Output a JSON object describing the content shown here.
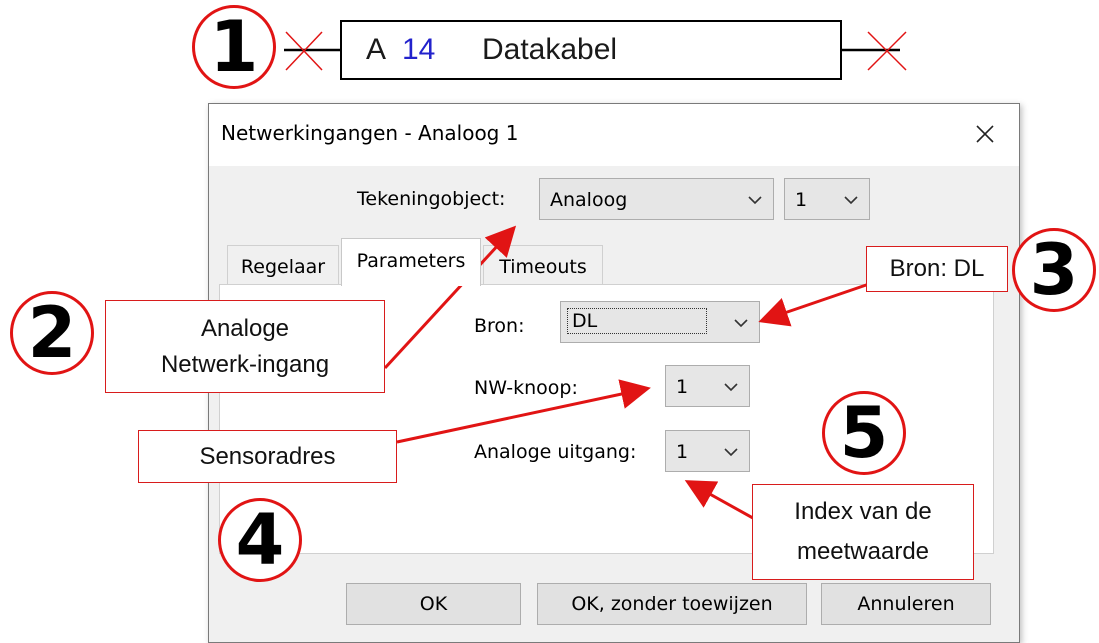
{
  "element": {
    "prefix": "A",
    "number": "14",
    "name": "Datakabel"
  },
  "callouts": [
    "1",
    "2",
    "3",
    "4",
    "5"
  ],
  "dialog": {
    "title": "Netwerkingangen - Analoog 1",
    "drawing_object_label": "Tekeningobject:",
    "drawing_object_value": "Analoog",
    "drawing_object_index": "1",
    "tabs": [
      {
        "label": "Regelaar",
        "active": false
      },
      {
        "label": "Parameters",
        "active": true
      },
      {
        "label": "Timeouts",
        "active": false
      }
    ],
    "fields": {
      "source_label": "Bron:",
      "source_value": "DL",
      "node_label": "NW-knoop:",
      "node_value": "1",
      "output_label": "Analoge uitgang:",
      "output_value": "1"
    },
    "buttons": {
      "ok": "OK",
      "ok_no_assign": "OK, zonder toewijzen",
      "cancel": "Annuleren"
    }
  },
  "annotations": {
    "analog_input_line1": "Analoge",
    "analog_input_line2": "Netwerk-ingang",
    "source_dl": "Bron: DL",
    "sensor_address": "Sensoradres",
    "index_line1": "Index van de",
    "index_line2": "meetwaarde"
  },
  "colors": {
    "annotation_red": "#e11414",
    "number_blue": "#2222cc",
    "dialog_background": "#f0f0f0"
  },
  "icons": {
    "close": "close-icon",
    "dropdown": "chevron-down-icon",
    "end_marker": "x-cross-icon"
  }
}
